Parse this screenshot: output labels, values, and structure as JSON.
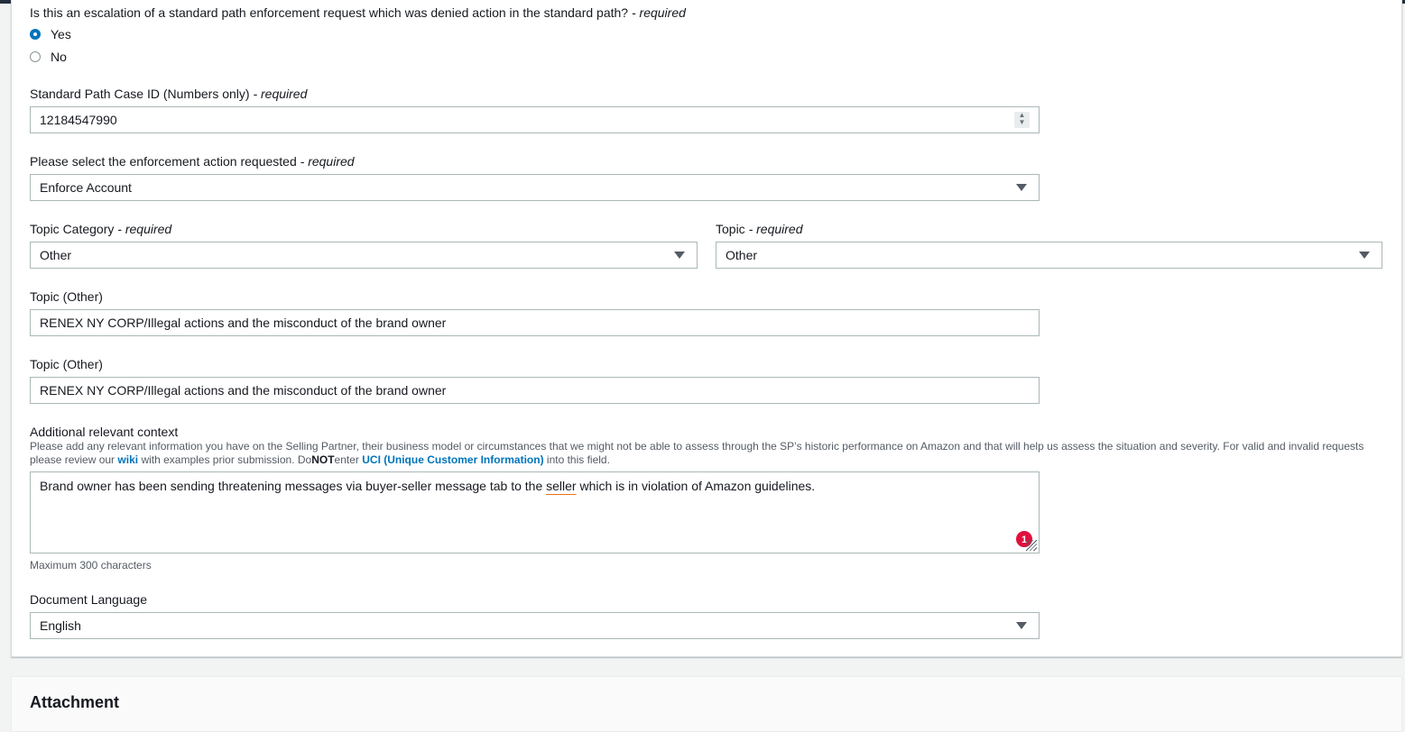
{
  "escalation": {
    "question": "Is this an escalation of a standard path enforcement request which was denied action in the standard path?",
    "required": "- required",
    "options": [
      {
        "label": "Yes",
        "checked": true
      },
      {
        "label": "No",
        "checked": false
      }
    ]
  },
  "case_id": {
    "label": "Standard Path Case ID (Numbers only)",
    "required": "- required",
    "value": "12184547990"
  },
  "enforcement_action": {
    "label": "Please select the enforcement action requested",
    "required": "- required",
    "value": "Enforce Account"
  },
  "topic_category": {
    "label": "Topic Category",
    "required": "- required",
    "value": "Other"
  },
  "topic": {
    "label": "Topic",
    "required": "- required",
    "value": "Other"
  },
  "topic_other_1": {
    "label": "Topic (Other)",
    "value": "RENEX NY CORP/Illegal actions and the misconduct of the brand owner"
  },
  "topic_other_2": {
    "label": "Topic (Other)",
    "value": "RENEX NY CORP/Illegal actions and the misconduct of the brand owner"
  },
  "context": {
    "label": "Additional relevant context",
    "hint_part1": "Please add any relevant information you have on the Selling Partner, their business model or circumstances that we might not be able to assess through the SP’s historic performance on Amazon and that will help us assess the situation and severity. For valid and invalid requests please review our",
    "wiki_link": "wiki",
    "hint_part2": "with examples prior submission. Do",
    "hint_not": "NOT",
    "hint_part3": "enter",
    "uci_link": "UCI (Unique Customer Information)",
    "hint_part4": "into this field.",
    "value_before": "Brand owner has been sending threatening messages via buyer-seller message tab to the ",
    "value_flagged": "seller",
    "value_after": " which is in violation of Amazon guidelines.",
    "badge_count": "1",
    "max_note": "Maximum 300 characters"
  },
  "language": {
    "label": "Document Language",
    "value": "English"
  },
  "attachment": {
    "title": "Attachment"
  },
  "colors": {
    "accent": "#0073bb",
    "badge": "#e0103f",
    "header": "#232f3e"
  }
}
